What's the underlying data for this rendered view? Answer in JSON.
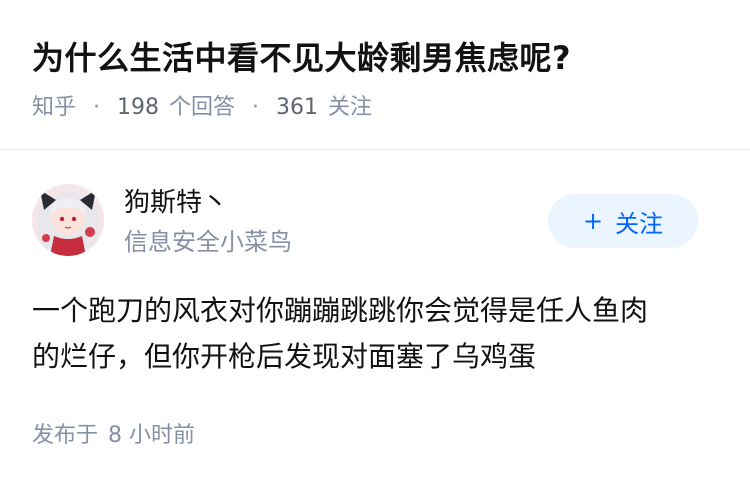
{
  "question": {
    "title": "为什么生活中看不见大龄剩男焦虑呢?",
    "source": "知乎",
    "answer_count": "198",
    "answer_label": "个回答",
    "follower_count": "361",
    "follower_label": "关注"
  },
  "author": {
    "name": "狗斯特丶",
    "bio": "信息安全小菜鸟",
    "follow_label": "关注",
    "follow_plus": "+"
  },
  "answer": {
    "lines": [
      "一个跑刀的风衣对你蹦蹦跳跳你会觉得是任人鱼肉",
      "的烂仔，但你开枪后发现对面塞了乌鸡蛋"
    ],
    "posted_label": "发布于",
    "posted_time": "8 小时前"
  },
  "colors": {
    "accent": "#0066ff",
    "follow_bg": "#ebf5ff",
    "meta_text": "#8590a6",
    "title_text": "#121212"
  }
}
